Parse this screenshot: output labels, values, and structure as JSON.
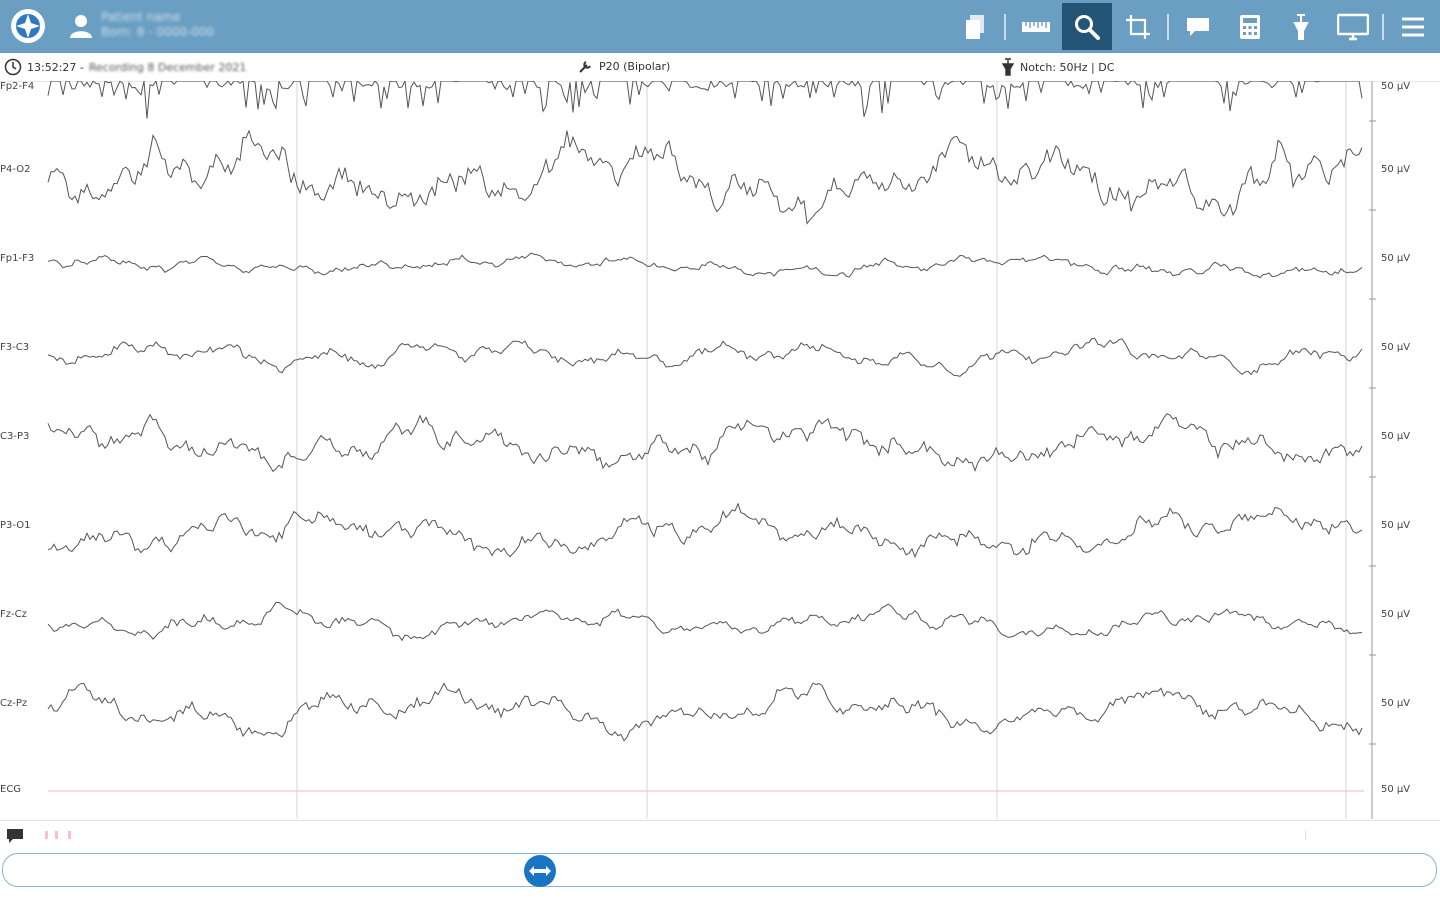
{
  "header": {
    "user_name": "Patient name",
    "user_detail": "Born: 8 - 0000-000",
    "icons": [
      "pages-icon",
      "ruler-icon",
      "search-icon",
      "crop-icon",
      "comment-icon",
      "calculator-icon",
      "filter-icon",
      "monitor-icon",
      "menu-icon"
    ],
    "active_tool": "search-icon"
  },
  "infobar": {
    "time": "13:52:27 -",
    "date_text": "Recording 8 December 2021",
    "montage": "P20 (Bipolar)",
    "filters": "Notch: 50Hz | DC"
  },
  "channels": [
    {
      "label": "Fp2-F4",
      "scale": "50 µV"
    },
    {
      "label": "P4-O2",
      "scale": "50 µV"
    },
    {
      "label": "Fp1-F3",
      "scale": "50 µV"
    },
    {
      "label": "F3-C3",
      "scale": "50 µV"
    },
    {
      "label": "C3-P3",
      "scale": "50 µV"
    },
    {
      "label": "P3-O1",
      "scale": "50 µV"
    },
    {
      "label": "Fz-Cz",
      "scale": "50 µV"
    },
    {
      "label": "Cz-Pz",
      "scale": "50 µV"
    },
    {
      "label": "ECG",
      "scale": "50 µV"
    }
  ],
  "colors": {
    "topbar": "#6a9ec2",
    "active_tool": "#245577",
    "trace": "#555555",
    "ecg_trace": "#f2b8b8",
    "slider_handle": "#1a74c4"
  }
}
